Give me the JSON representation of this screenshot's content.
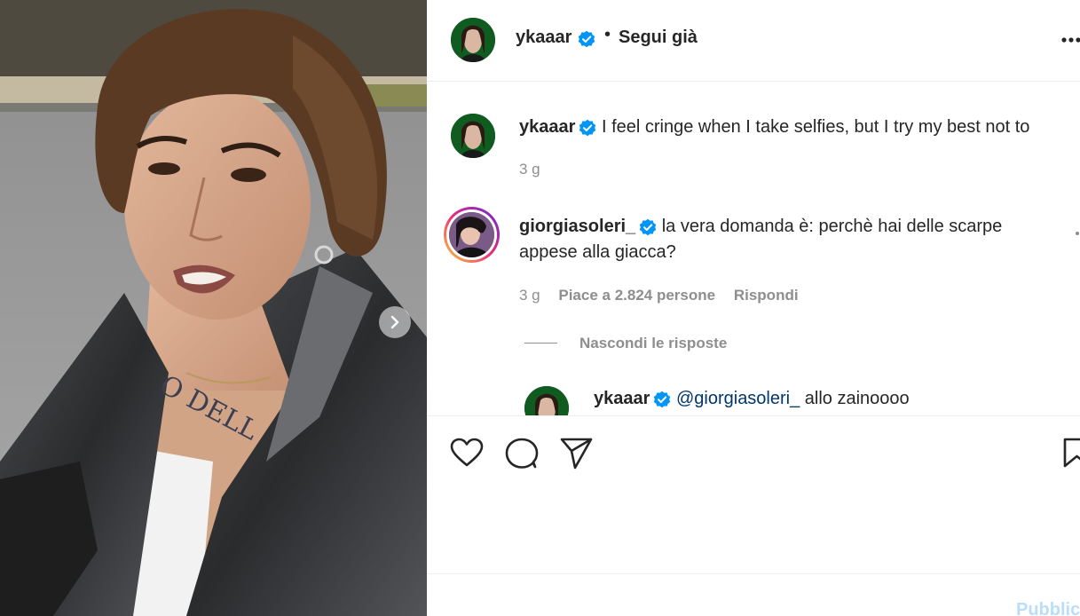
{
  "post": {
    "author": "ykaaar",
    "follow_status": "Segui già",
    "separator": "•"
  },
  "caption": {
    "username": "ykaaar",
    "text": "I feel cringe when I take selfies, but I try my best not to",
    "time": "3 g"
  },
  "comments": [
    {
      "username": "giorgiasoleri_",
      "text": "la vera domanda è: perchè hai delle scarpe appese alla giacca?",
      "time": "3 g",
      "likes": "Piace a 2.824 persone",
      "reply_label": "Rispondi",
      "hide_replies_label": "Nascondi le risposte"
    }
  ],
  "reply": {
    "username": "ykaaar",
    "mention": "@giorgiasoleri_",
    "text": "allo zainoooo"
  },
  "footer": {
    "publish_label": "Pubblica"
  },
  "photo": {
    "tattoo_text": "O DELL"
  },
  "colors": {
    "verified": "#0095f6",
    "avatar_bg": "#0f5b20",
    "story_ring_start": "#f9ce34",
    "story_ring_end": "#ee2a7b"
  },
  "icons": [
    "verified-badge-icon",
    "more-options-icon",
    "heart-icon",
    "comment-icon",
    "share-icon",
    "bookmark-icon",
    "chevron-right-icon"
  ]
}
